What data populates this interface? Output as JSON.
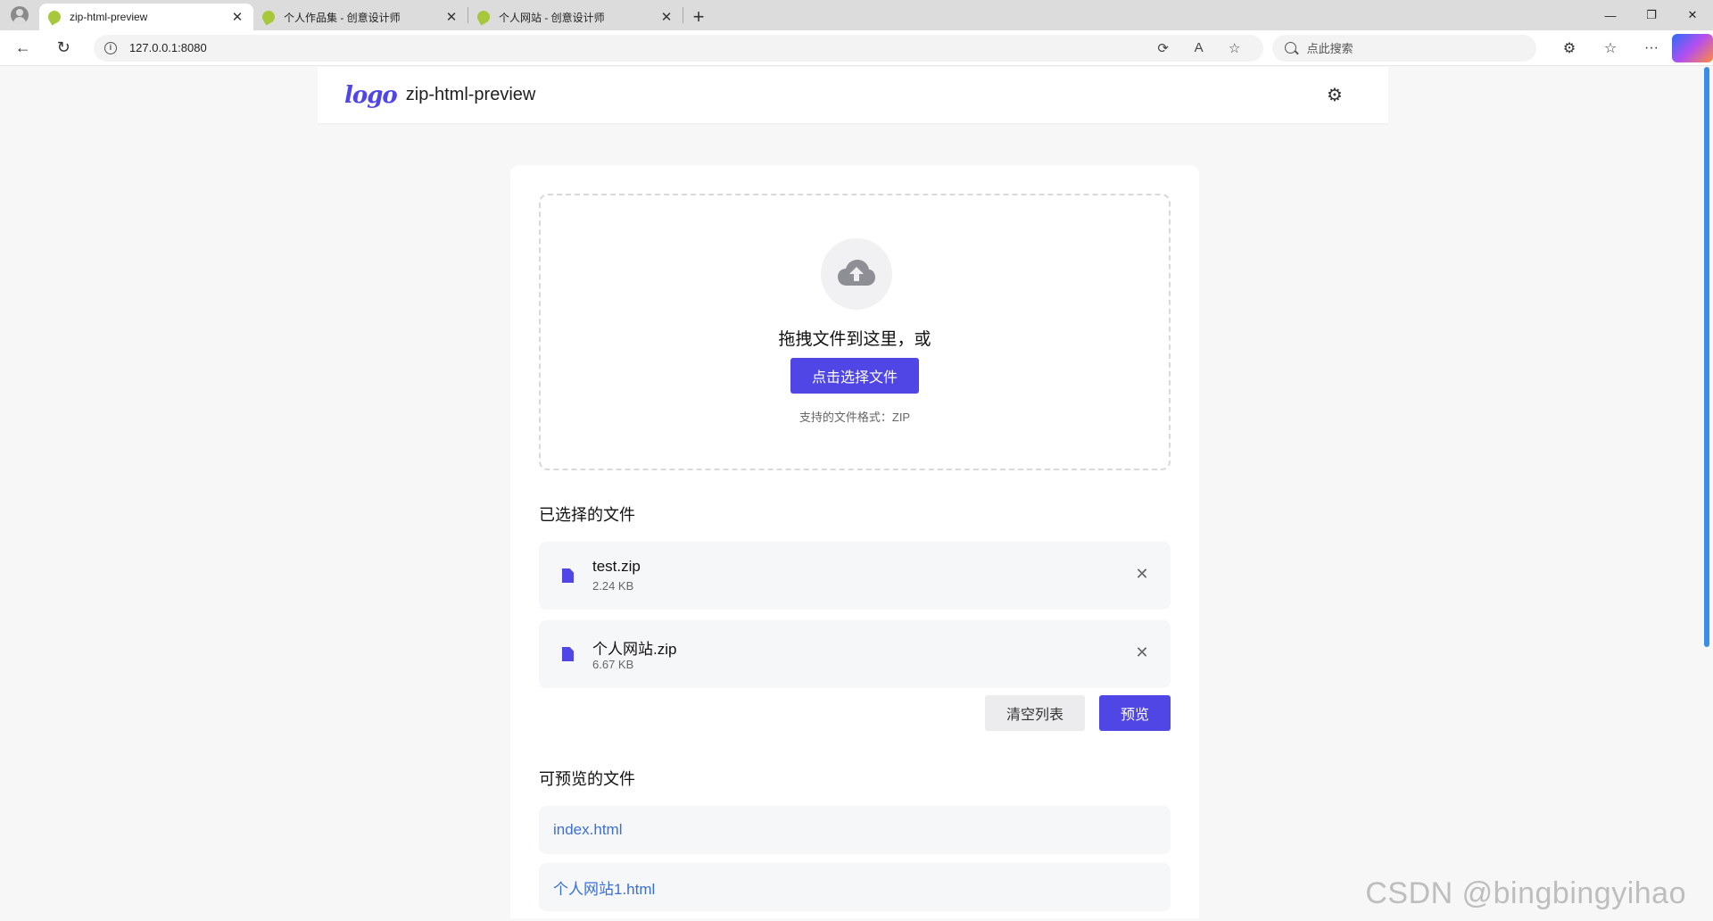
{
  "browser": {
    "tabs": [
      {
        "title": "zip-html-preview",
        "active": true
      },
      {
        "title": "个人作品集 - 创意设计师",
        "active": false
      },
      {
        "title": "个人网站 - 创意设计师",
        "active": false
      }
    ],
    "new_tab": "+",
    "window_controls": {
      "minimize": "—",
      "restore": "❐",
      "close": "✕"
    },
    "nav": {
      "back": "←",
      "reload": "↻"
    },
    "url": "127.0.0.1:8080",
    "search_placeholder": "点此搜索",
    "copilot_color": "#4f46e5"
  },
  "app": {
    "logo_text": "logo",
    "title": "zip-html-preview",
    "accent_color": "#4f46e5"
  },
  "upload": {
    "drop_text": "拖拽文件到这里，或",
    "select_button": "点击选择文件",
    "formats_text": "支持的文件格式：ZIP"
  },
  "selected": {
    "heading": "已选择的文件",
    "files": [
      {
        "name": "test.zip",
        "size": "2.24 KB"
      },
      {
        "name": "个人网站.zip",
        "size": "6.67 KB"
      }
    ],
    "clear_button": "清空列表",
    "preview_button": "预览"
  },
  "previewable": {
    "heading": "可预览的文件",
    "files": [
      "index.html",
      "个人网站1.html"
    ]
  },
  "watermark": "CSDN @bingbingyihao"
}
